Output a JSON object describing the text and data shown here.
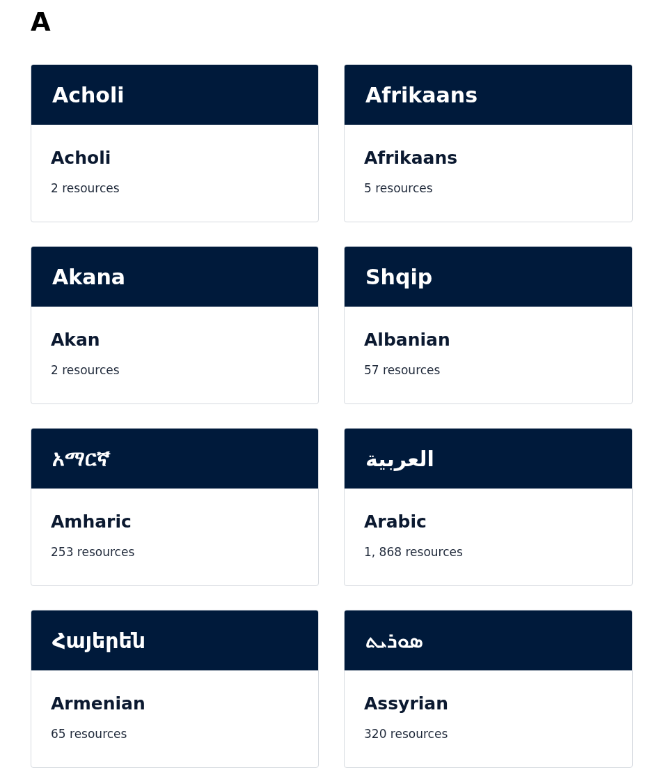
{
  "heading": "A",
  "languages": [
    {
      "native_name": "Acholi",
      "name": "Acholi",
      "resources": "2 resources"
    },
    {
      "native_name": "Afrikaans",
      "name": "Afrikaans",
      "resources": "5 resources"
    },
    {
      "native_name": "Akana",
      "name": "Akan",
      "resources": "2 resources"
    },
    {
      "native_name": "Shqip",
      "name": "Albanian",
      "resources": "57 resources"
    },
    {
      "native_name": "አማርኛ",
      "name": "Amharic",
      "resources": "253 resources"
    },
    {
      "native_name": "العربية",
      "name": "Arabic",
      "resources": "1, 868 resources"
    },
    {
      "native_name": "Հայերեն",
      "name": "Armenian",
      "resources": "65 resources"
    },
    {
      "native_name": "ܣܘܪܝܬ",
      "name": "Assyrian",
      "resources": "320 resources"
    }
  ]
}
